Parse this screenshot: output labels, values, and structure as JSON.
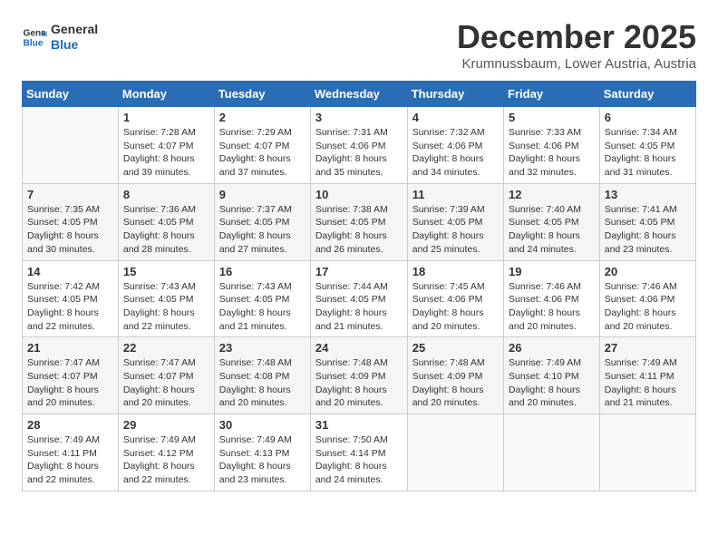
{
  "logo": {
    "line1": "General",
    "line2": "Blue"
  },
  "title": "December 2025",
  "location": "Krumnussbaum, Lower Austria, Austria",
  "days_of_week": [
    "Sunday",
    "Monday",
    "Tuesday",
    "Wednesday",
    "Thursday",
    "Friday",
    "Saturday"
  ],
  "weeks": [
    [
      {
        "day": "",
        "detail": ""
      },
      {
        "day": "1",
        "detail": "Sunrise: 7:28 AM\nSunset: 4:07 PM\nDaylight: 8 hours\nand 39 minutes."
      },
      {
        "day": "2",
        "detail": "Sunrise: 7:29 AM\nSunset: 4:07 PM\nDaylight: 8 hours\nand 37 minutes."
      },
      {
        "day": "3",
        "detail": "Sunrise: 7:31 AM\nSunset: 4:06 PM\nDaylight: 8 hours\nand 35 minutes."
      },
      {
        "day": "4",
        "detail": "Sunrise: 7:32 AM\nSunset: 4:06 PM\nDaylight: 8 hours\nand 34 minutes."
      },
      {
        "day": "5",
        "detail": "Sunrise: 7:33 AM\nSunset: 4:06 PM\nDaylight: 8 hours\nand 32 minutes."
      },
      {
        "day": "6",
        "detail": "Sunrise: 7:34 AM\nSunset: 4:05 PM\nDaylight: 8 hours\nand 31 minutes."
      }
    ],
    [
      {
        "day": "7",
        "detail": "Sunrise: 7:35 AM\nSunset: 4:05 PM\nDaylight: 8 hours\nand 30 minutes."
      },
      {
        "day": "8",
        "detail": "Sunrise: 7:36 AM\nSunset: 4:05 PM\nDaylight: 8 hours\nand 28 minutes."
      },
      {
        "day": "9",
        "detail": "Sunrise: 7:37 AM\nSunset: 4:05 PM\nDaylight: 8 hours\nand 27 minutes."
      },
      {
        "day": "10",
        "detail": "Sunrise: 7:38 AM\nSunset: 4:05 PM\nDaylight: 8 hours\nand 26 minutes."
      },
      {
        "day": "11",
        "detail": "Sunrise: 7:39 AM\nSunset: 4:05 PM\nDaylight: 8 hours\nand 25 minutes."
      },
      {
        "day": "12",
        "detail": "Sunrise: 7:40 AM\nSunset: 4:05 PM\nDaylight: 8 hours\nand 24 minutes."
      },
      {
        "day": "13",
        "detail": "Sunrise: 7:41 AM\nSunset: 4:05 PM\nDaylight: 8 hours\nand 23 minutes."
      }
    ],
    [
      {
        "day": "14",
        "detail": "Sunrise: 7:42 AM\nSunset: 4:05 PM\nDaylight: 8 hours\nand 22 minutes."
      },
      {
        "day": "15",
        "detail": "Sunrise: 7:43 AM\nSunset: 4:05 PM\nDaylight: 8 hours\nand 22 minutes."
      },
      {
        "day": "16",
        "detail": "Sunrise: 7:43 AM\nSunset: 4:05 PM\nDaylight: 8 hours\nand 21 minutes."
      },
      {
        "day": "17",
        "detail": "Sunrise: 7:44 AM\nSunset: 4:05 PM\nDaylight: 8 hours\nand 21 minutes."
      },
      {
        "day": "18",
        "detail": "Sunrise: 7:45 AM\nSunset: 4:06 PM\nDaylight: 8 hours\nand 20 minutes."
      },
      {
        "day": "19",
        "detail": "Sunrise: 7:46 AM\nSunset: 4:06 PM\nDaylight: 8 hours\nand 20 minutes."
      },
      {
        "day": "20",
        "detail": "Sunrise: 7:46 AM\nSunset: 4:06 PM\nDaylight: 8 hours\nand 20 minutes."
      }
    ],
    [
      {
        "day": "21",
        "detail": "Sunrise: 7:47 AM\nSunset: 4:07 PM\nDaylight: 8 hours\nand 20 minutes."
      },
      {
        "day": "22",
        "detail": "Sunrise: 7:47 AM\nSunset: 4:07 PM\nDaylight: 8 hours\nand 20 minutes."
      },
      {
        "day": "23",
        "detail": "Sunrise: 7:48 AM\nSunset: 4:08 PM\nDaylight: 8 hours\nand 20 minutes."
      },
      {
        "day": "24",
        "detail": "Sunrise: 7:48 AM\nSunset: 4:09 PM\nDaylight: 8 hours\nand 20 minutes."
      },
      {
        "day": "25",
        "detail": "Sunrise: 7:48 AM\nSunset: 4:09 PM\nDaylight: 8 hours\nand 20 minutes."
      },
      {
        "day": "26",
        "detail": "Sunrise: 7:49 AM\nSunset: 4:10 PM\nDaylight: 8 hours\nand 20 minutes."
      },
      {
        "day": "27",
        "detail": "Sunrise: 7:49 AM\nSunset: 4:11 PM\nDaylight: 8 hours\nand 21 minutes."
      }
    ],
    [
      {
        "day": "28",
        "detail": "Sunrise: 7:49 AM\nSunset: 4:11 PM\nDaylight: 8 hours\nand 22 minutes."
      },
      {
        "day": "29",
        "detail": "Sunrise: 7:49 AM\nSunset: 4:12 PM\nDaylight: 8 hours\nand 22 minutes."
      },
      {
        "day": "30",
        "detail": "Sunrise: 7:49 AM\nSunset: 4:13 PM\nDaylight: 8 hours\nand 23 minutes."
      },
      {
        "day": "31",
        "detail": "Sunrise: 7:50 AM\nSunset: 4:14 PM\nDaylight: 8 hours\nand 24 minutes."
      },
      {
        "day": "",
        "detail": ""
      },
      {
        "day": "",
        "detail": ""
      },
      {
        "day": "",
        "detail": ""
      }
    ]
  ]
}
